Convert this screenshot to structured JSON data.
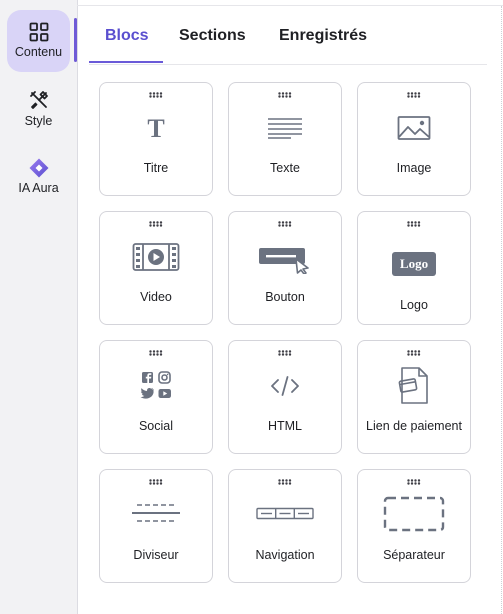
{
  "sidebar": {
    "items": [
      {
        "label": "Contenu",
        "icon": "grid-icon",
        "active": true
      },
      {
        "label": "Style",
        "icon": "brush-icon",
        "active": false
      },
      {
        "label": "IA Aura",
        "icon": "ai-diamond-icon",
        "active": false
      }
    ]
  },
  "tabs": [
    {
      "label": "Blocs",
      "active": true
    },
    {
      "label": "Sections",
      "active": false
    },
    {
      "label": "Enregistrés",
      "active": false
    }
  ],
  "blocks": [
    {
      "label": "Titre",
      "icon": "heading-icon"
    },
    {
      "label": "Texte",
      "icon": "text-lines-icon"
    },
    {
      "label": "Image",
      "icon": "image-icon"
    },
    {
      "label": "Video",
      "icon": "video-icon"
    },
    {
      "label": "Bouton",
      "icon": "button-icon"
    },
    {
      "label": "Logo",
      "icon": "logo-icon",
      "badge": "Logo"
    },
    {
      "label": "Social",
      "icon": "social-icon"
    },
    {
      "label": "HTML",
      "icon": "code-icon"
    },
    {
      "label": "Lien de paiement",
      "icon": "payment-link-icon"
    },
    {
      "label": "Diviseur",
      "icon": "divider-icon"
    },
    {
      "label": "Navigation",
      "icon": "navigation-icon"
    },
    {
      "label": "Séparateur",
      "icon": "spacer-icon"
    }
  ],
  "colors": {
    "accent": "#5a4fcf",
    "active_bg": "#d9d4f7",
    "icon_gray": "#6b7280",
    "card_border": "#d4d4da"
  }
}
